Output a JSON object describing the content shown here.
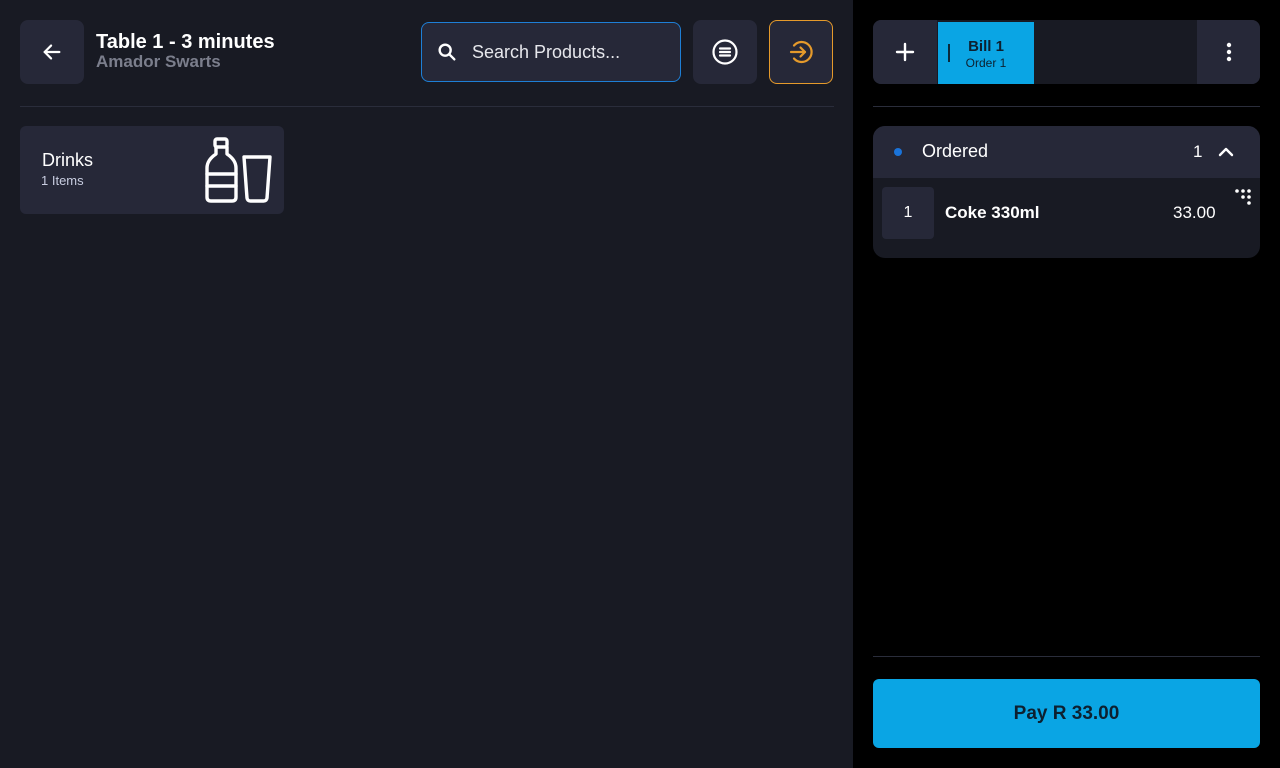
{
  "header": {
    "title": "Table 1 - 3 minutes",
    "subtitle": "Amador Swarts",
    "back_icon": "arrow-left-icon"
  },
  "search": {
    "placeholder": "Search Products...",
    "value": "",
    "icon": "search-icon"
  },
  "toolbar": {
    "menu_icon": "list-circle-icon",
    "exit_icon": "arrow-right-circle-icon"
  },
  "categories": [
    {
      "name": "Drinks",
      "count_label": "1 Items",
      "icon": "bottle-and-glass-icon"
    }
  ],
  "bills": {
    "add_icon": "plus-icon",
    "more_icon": "more-vertical-icon",
    "tabs": [
      {
        "label": "Bill 1",
        "sub_label": "Order 1"
      }
    ]
  },
  "order_group": {
    "status": "Ordered",
    "count": "1",
    "items": [
      {
        "qty": "1",
        "name": "Coke 330ml",
        "price": "33.00"
      }
    ]
  },
  "pay_button": {
    "label": "Pay R 33.00"
  },
  "colors": {
    "accent": "#0aa5e4",
    "exit_border": "#e59a2b",
    "search_border": "#1e7fd6",
    "status_dot": "#1a73d9"
  }
}
